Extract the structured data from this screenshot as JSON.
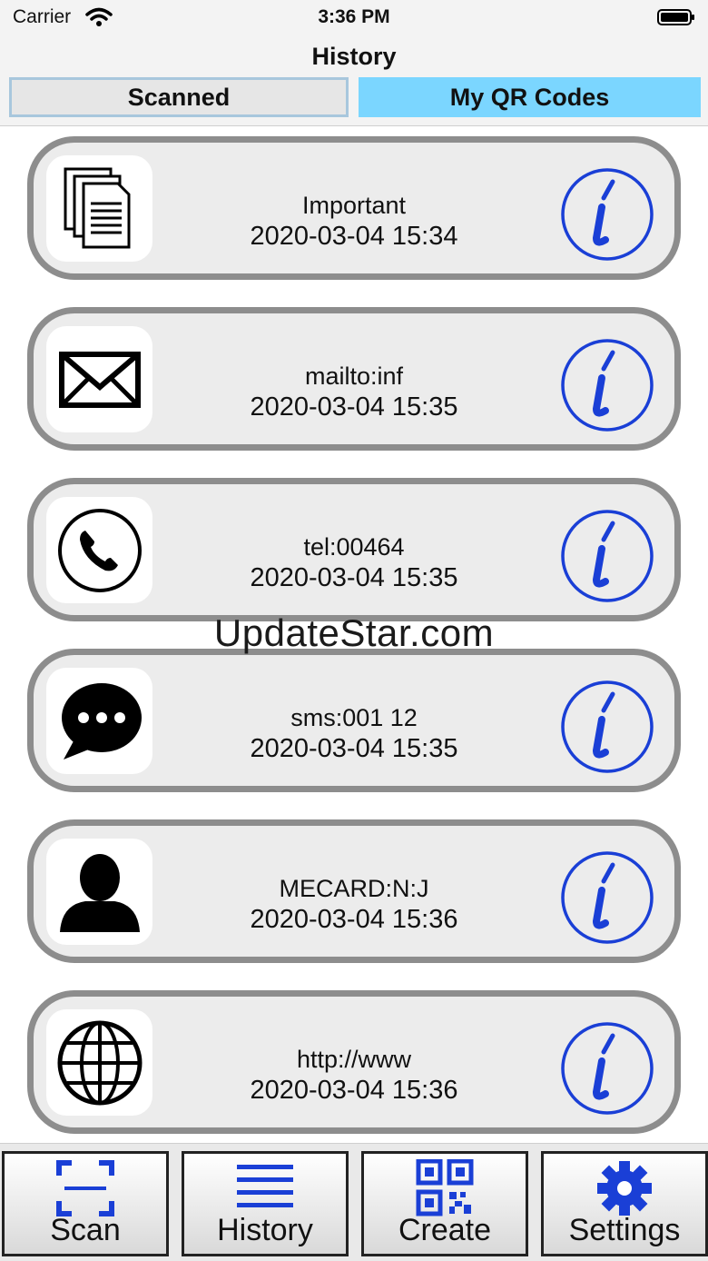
{
  "status_bar": {
    "carrier": "Carrier",
    "time": "3:36 PM"
  },
  "nav": {
    "title": "History"
  },
  "segments": [
    {
      "label": "Scanned",
      "selected": false
    },
    {
      "label": "My QR Codes",
      "selected": true
    }
  ],
  "items": [
    {
      "icon": "documents-icon",
      "title": "Important",
      "date": "2020-03-04  15:34"
    },
    {
      "icon": "envelope-icon",
      "title": "mailto:inf",
      "date": "2020-03-04  15:35"
    },
    {
      "icon": "phone-icon",
      "title": "tel:00464",
      "date": "2020-03-04  15:35"
    },
    {
      "icon": "chat-bubble-icon",
      "title": "sms:001 12",
      "date": "2020-03-04  15:35"
    },
    {
      "icon": "person-icon",
      "title": "MECARD:N:J",
      "date": "2020-03-04  15:36"
    },
    {
      "icon": "globe-icon",
      "title": "http://www",
      "date": "2020-03-04  15:36"
    }
  ],
  "watermark": "UpdateStar.com",
  "tabs": [
    {
      "label": "Scan",
      "icon": "scan-frame-icon"
    },
    {
      "label": "History",
      "icon": "list-lines-icon"
    },
    {
      "label": "Create",
      "icon": "qr-code-icon"
    },
    {
      "label": "Settings",
      "icon": "gear-icon"
    }
  ],
  "colors": {
    "accent": "#7bd6ff",
    "icon_blue": "#1a3fd6",
    "card_border": "#8d8d8d"
  }
}
